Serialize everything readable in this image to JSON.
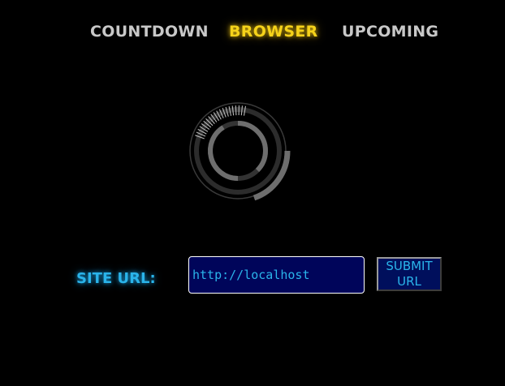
{
  "nav": {
    "tabs": [
      {
        "label": "COUNTDOWN",
        "active": false
      },
      {
        "label": "BROWSER",
        "active": true
      },
      {
        "label": "UPCOMING",
        "active": false
      }
    ]
  },
  "form": {
    "label": "SITE URL:",
    "url_value": "http://localhost",
    "submit_line1": "SUBMIT",
    "submit_line2": "URL"
  },
  "colors": {
    "background": "#000000",
    "active_tab": "#f5d21a",
    "inactive_tab": "#c8c8c8",
    "accent_blue": "#2ab4ea",
    "input_bg": "#00055a",
    "spinner_gray": "#6e6e6e"
  },
  "icons": {
    "loader": "loading-spinner-icon"
  }
}
